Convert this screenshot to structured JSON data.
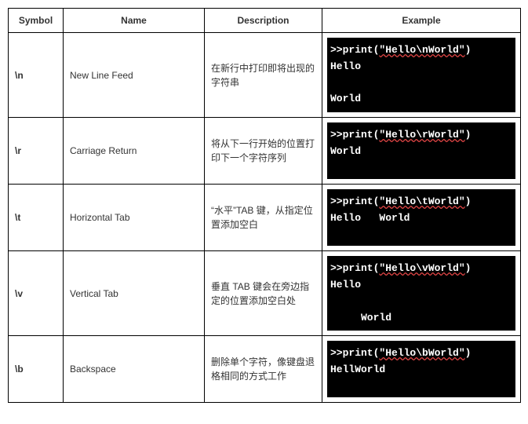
{
  "headers": {
    "symbol": "Symbol",
    "name": "Name",
    "description": "Description",
    "example": "Example"
  },
  "rows": [
    {
      "symbol": "\\n",
      "name": "New Line Feed",
      "description": "在新行中打印即将出现的字符串",
      "cmd_prefix": ">>print(",
      "cmd_string": "\"Hello\\nWorld\"",
      "cmd_suffix": ")",
      "output": "\nHello\n\nWorld"
    },
    {
      "symbol": "\\r",
      "name": "Carriage Return",
      "description": "将从下一行开始的位置打印下一个字符序列",
      "cmd_prefix": ">>print(",
      "cmd_string": "\"Hello\\rWorld\"",
      "cmd_suffix": ")",
      "output": "\nWorld"
    },
    {
      "symbol": "\\t",
      "name": "Horizontal Tab",
      "description": "“水平”TAB 键，从指定位置添加空白",
      "cmd_prefix": ">>print(",
      "cmd_string": "\"Hello\\tWorld\"",
      "cmd_suffix": ")",
      "output": "\nHello   World"
    },
    {
      "symbol": "\\v",
      "name": "Vertical Tab",
      "description": "垂直 TAB 键会在旁边指定的位置添加空白处",
      "cmd_prefix": ">>print(",
      "cmd_string": "\"Hello\\vWorld\"",
      "cmd_suffix": ")",
      "output": "\nHello\n\n     World"
    },
    {
      "symbol": "\\b",
      "name": "Backspace",
      "description": "删除单个字符，像键盘退格相同的方式工作",
      "cmd_prefix": ">>print(",
      "cmd_string": "\"Hello\\bWorld\"",
      "cmd_suffix": ")",
      "output": "\nHellWorld"
    }
  ]
}
